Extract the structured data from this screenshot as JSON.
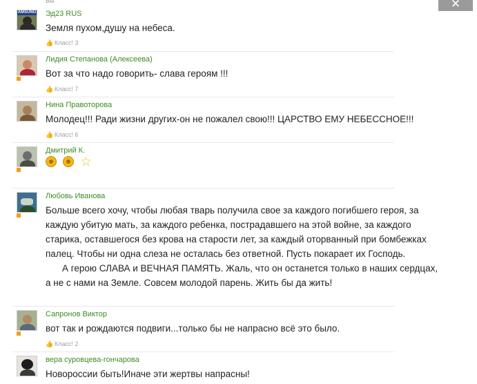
{
  "close_label": "✕",
  "top_remnant": "Вы",
  "like_icon": "thumbs-up-icon",
  "colors": {
    "author_name": "#3c8c22",
    "comment_text": "#222222",
    "meta_text": "#a0a0a0",
    "badge": "#f59d1c",
    "close_button": "#9a9a9a"
  },
  "comments": [
    {
      "author": "Эд23 RUS",
      "avatar_label": "AMSUNG",
      "text": "Земля пухом,душу на небеса.",
      "likes": "Класс! 3"
    },
    {
      "author": "Лидия Степанова (Алексеева)",
      "text": "Вот за что надо говорить- слава героям !!!",
      "likes": "Класс! 7"
    },
    {
      "author": "Нина Правоторова",
      "text": "Молодец!!! Ради жизни других-он не пожалел свою!!! ЦАРСТВО ЕМУ НЕБЕССНОЕ!!!",
      "likes": "Класс! 6"
    },
    {
      "author": "Дмитрий К.",
      "stickers": [
        "sunflower-sticker",
        "sunflower-sticker",
        "star-sticker"
      ]
    },
    {
      "author": "Любовь Иванова",
      "lines": [
        "Больше всего хочу, чтобы любая тварь получила свое за каждого погибшего героя, за",
        "каждую убитую мать, за каждого ребенка, пострадавшего на этой войне, за каждого",
        "старика, оставшегося без крова на старости лет, за каждый оторванный  при бомбежках",
        "палец. Чтобы ни одна слеза не осталась без ответной. Пусть покарает их Господь.",
        "А герою СЛАВА и ВЕЧНАЯ ПАМЯТЬ. Жаль, что он останется только в наших сердцах,",
        "а не с нами  на Земле. Совсем молодой парень. Жить бы да жить!"
      ]
    },
    {
      "author": "Сапронов Виктор",
      "text": "вот так и рождаются подвиги...только бы не напрасно всё это было.",
      "likes": "Класс! 2"
    },
    {
      "author": "вера суровцева-гончарова",
      "text": "Новороссии быть!Иначе эти жертвы напрасны!"
    }
  ]
}
